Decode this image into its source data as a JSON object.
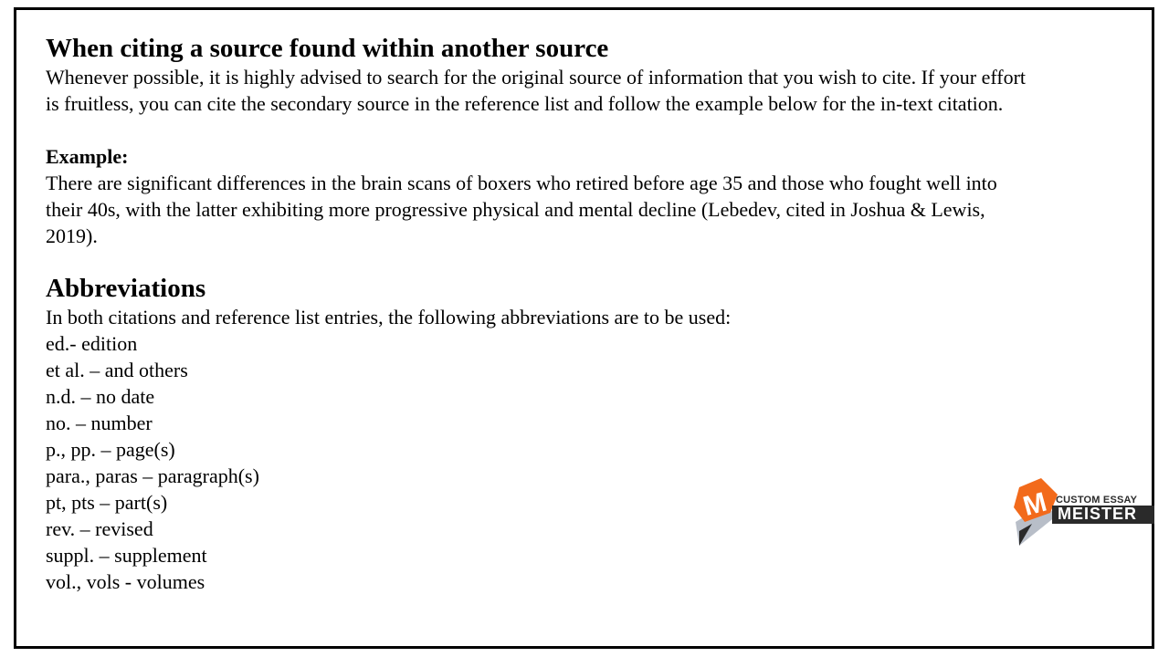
{
  "section1": {
    "heading": "When citing a source found within another source",
    "intro_line1": "Whenever possible, it is highly advised to search for the original source of information that you wish to cite. If your effort",
    "intro_line2": "is fruitless, you can cite the secondary source in the reference list and follow the example below for the in-text citation.",
    "example_label": "Example:",
    "example_line1": "There are significant differences in the brain scans of boxers who retired before age 35 and those who fought well into",
    "example_line2": "their 40s, with the latter exhibiting more progressive physical and mental decline (Lebedev, cited in Joshua & Lewis,",
    "example_line3": "2019)."
  },
  "section2": {
    "heading": "Abbreviations",
    "intro": "In both citations and reference list entries, the following abbreviations are to be used:",
    "items": [
      "ed.- edition",
      "et al. – and others",
      "n.d. – no date",
      "no. – number",
      "p., pp. – page(s)",
      "para., paras – paragraph(s)",
      "pt, pts – part(s)",
      "rev. – revised",
      "suppl. – supplement",
      "vol., vols - volumes"
    ]
  },
  "logo": {
    "line1": "CUSTOM ESSAY",
    "line2": "MEISTER",
    "letter": "M",
    "colors": {
      "orange": "#f26a1b",
      "dark": "#2a2a2a",
      "pencil_gray": "#b8bec8"
    }
  }
}
